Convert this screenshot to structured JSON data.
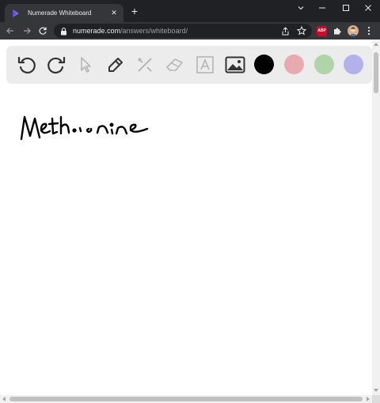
{
  "browser": {
    "tab": {
      "title": "Numerade Whiteboard",
      "close_icon": "close-icon",
      "favicon": "numerade-logo-icon"
    },
    "new_tab_label": "+",
    "window_controls": [
      "chevron-down-icon",
      "minimize-icon",
      "maximize-icon",
      "close-icon"
    ],
    "address": {
      "host": "numerade.com",
      "path": "/answers/whiteboard/"
    },
    "extension_badge": "ABP"
  },
  "toolbar": {
    "tools": [
      "undo-icon",
      "redo-icon",
      "select-pointer-icon",
      "pen-icon",
      "tools-icon",
      "eraser-icon",
      "text-icon",
      "image-icon"
    ],
    "colors": [
      {
        "name": "black",
        "hex": "#000000",
        "selected": true
      },
      {
        "name": "pink",
        "hex": "#e8aab0",
        "selected": false
      },
      {
        "name": "green",
        "hex": "#aed4a8",
        "selected": false
      },
      {
        "name": "purple",
        "hex": "#b3b1ea",
        "selected": false
      }
    ]
  },
  "canvas": {
    "handwriting": "Methionine",
    "ink_color": "#000000"
  }
}
